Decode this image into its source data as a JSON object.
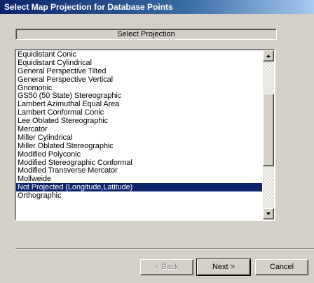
{
  "window": {
    "title": "Select Map Projection for Database Points"
  },
  "header": {
    "label": "Select Projection"
  },
  "projections": {
    "items": [
      "Equidistant Conic",
      "Equidistant Cylindrical",
      "General Perspective Tilted",
      "General Perspective Vertical",
      "Gnomonic",
      "GS50 (50 State) Stereographic",
      "Lambert Azimuthal Equal Area",
      "Lambert Conformal Conic",
      "Lee Oblated Stereographic",
      "Mercator",
      "Miller Cylindrical",
      "Miller Oblated Stereographic",
      "Modified Polyconic",
      "Modified Stereographic Conformal",
      "Modified Transverse Mercator",
      "Mollweide",
      "Not Projected (Longitude,Latitude)",
      "Orthographic"
    ],
    "selected": "Not Projected (Longitude,Latitude)"
  },
  "buttons": {
    "back": "< Back",
    "next": "Next >",
    "cancel": "Cancel"
  },
  "colors": {
    "title_bar": "#0a246a",
    "selection": "#0a246a",
    "dialog_bg": "#d4d0c8"
  }
}
